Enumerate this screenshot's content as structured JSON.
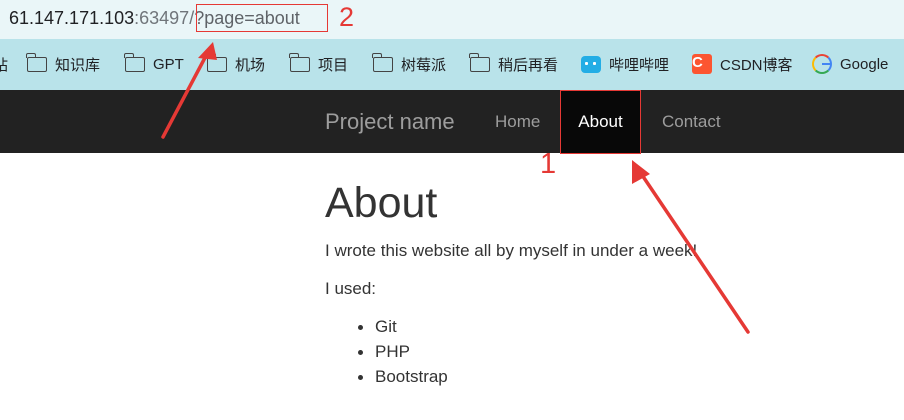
{
  "browser": {
    "url_host": "61.147.171.103",
    "url_port": ":63497",
    "url_slash": "/",
    "url_query": "?page=about"
  },
  "bookmarks": [
    {
      "label": "知识库",
      "icon": "folder-icon"
    },
    {
      "label": "GPT",
      "icon": "folder-icon"
    },
    {
      "label": "机场",
      "icon": "folder-icon"
    },
    {
      "label": "项目",
      "icon": "folder-icon"
    },
    {
      "label": "树莓派",
      "icon": "folder-icon"
    },
    {
      "label": "稍后再看",
      "icon": "folder-icon"
    },
    {
      "label": "哔哩哔哩",
      "icon": "bilibili-icon"
    },
    {
      "label": "CSDN博客",
      "icon": "csdn-icon"
    },
    {
      "label": "Google",
      "icon": "google-icon"
    }
  ],
  "navbar": {
    "brand": "Project name",
    "links": [
      "Home",
      "About",
      "Contact"
    ],
    "active": "About"
  },
  "page": {
    "title": "About",
    "intro": "I wrote this website all by myself in under a week!",
    "used_label": "I used:",
    "tools": [
      "Git",
      "PHP",
      "Bootstrap"
    ]
  },
  "annotations": {
    "label_1": "1",
    "label_2": "2",
    "color": "#e53935"
  },
  "colors": {
    "navbar_bg": "#222222",
    "navbar_active_bg": "#080808",
    "bookmarks_bg": "#b9e3ea",
    "urlbar_bg": "#eaf6f8"
  }
}
